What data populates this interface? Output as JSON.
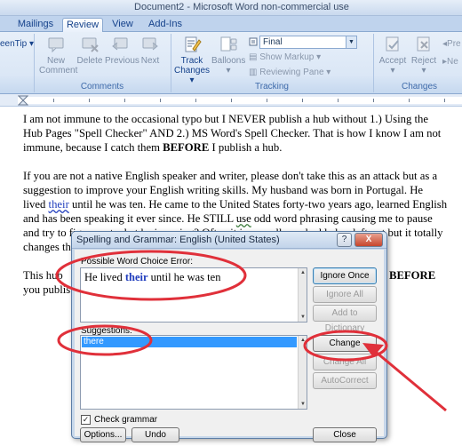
{
  "window": {
    "title": "Document2 - Microsoft Word non-commercial use"
  },
  "tabs": [
    {
      "label": "Mailings",
      "active": false
    },
    {
      "label": "Review",
      "active": true
    },
    {
      "label": "View",
      "active": false
    },
    {
      "label": "Add-Ins",
      "active": false
    }
  ],
  "ribbon": {
    "left_cut_label": "eenTip",
    "comments": {
      "group_label": "Comments",
      "new": "New\nComment",
      "delete": "Delete",
      "previous": "Previous",
      "next": "Next"
    },
    "tracking": {
      "group_label": "Tracking",
      "track_changes": "Track\nChanges",
      "balloons": "Balloons",
      "display_value": "Final",
      "show_markup": "Show Markup",
      "reviewing_pane": "Reviewing Pane"
    },
    "changes": {
      "group_label": "Changes",
      "accept": "Accept",
      "reject": "Reject",
      "previous_cut": "Pre",
      "next_cut": "Ne"
    }
  },
  "document": {
    "p1": {
      "before": "I am not immune  to the occasional typo but I NEVER publish a hub without 1.) Using the Hub Pages \"Spell Checker\" AND 2.) MS Word's Spell Checker. That is how I know I am not immune, because I catch them ",
      "bold": "BEFORE",
      "after": " I publish  a hub."
    },
    "p2": {
      "before": "If you are not a native English speaker and writer, please don't take this as an attack but as a suggestion to improve your English writing skills.  My husband was born in Portugal. He lived ",
      "error_word": "their",
      "middle": " until he was ten. He came to the United States forty-two years ago, learned English and has been speaking it ever since. He STILL ",
      "flag_word": "use",
      "after": " odd word phrasing causing me to pause and try to figure out what he is saying? Often it is a small word added or left out but it totally changes the meaning o"
    },
    "p3": {
      "start": "This hub",
      "line2_start": "you publis",
      "right_bold": "BEFORE"
    }
  },
  "dialog": {
    "title": "Spelling and Grammar: English (United States)",
    "help_btn": "?",
    "close_btn": "X",
    "error_label": "Possible Word Choice Error:",
    "sentence_before": "He lived ",
    "sentence_word": "their",
    "sentence_after": " until he was ten",
    "suggestions_label": "Suggestions:",
    "suggestion": "there",
    "buttons": {
      "ignore_once": "Ignore Once",
      "ignore_all": "Ignore All",
      "add_to_dictionary": "Add to Dictionary",
      "change": "Change",
      "change_all": "Change All",
      "autocorrect": "AutoCorrect",
      "options": "Options...",
      "undo": "Undo",
      "close": "Close"
    },
    "check_grammar_label": "Check grammar",
    "check_grammar_checked": true
  },
  "annotation_color": "#e0303a"
}
